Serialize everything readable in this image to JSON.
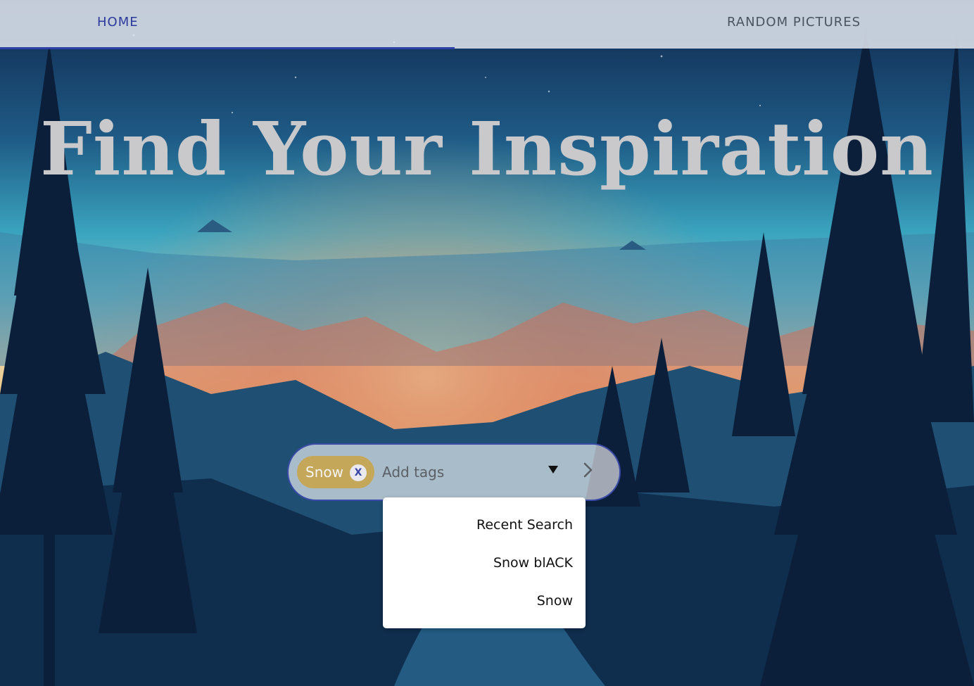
{
  "nav": {
    "tabs": [
      {
        "label": "HOME",
        "active": true
      },
      {
        "label": "RANDOM PICTURES",
        "active": false
      }
    ],
    "active_color": "#2f3fa8"
  },
  "hero": {
    "title": "Find Your Inspiration"
  },
  "search": {
    "chips": [
      {
        "label": "Snow",
        "remove_label": "X"
      }
    ],
    "placeholder": "Add tags",
    "chip_color": "#c4a759",
    "border_color": "#3a4aa8"
  },
  "menu": {
    "items": [
      "Recent Search",
      "Snow blACK",
      "Snow"
    ]
  },
  "icons": {
    "dropdown": "caret-down-icon",
    "submit": "chevron-right-icon"
  }
}
